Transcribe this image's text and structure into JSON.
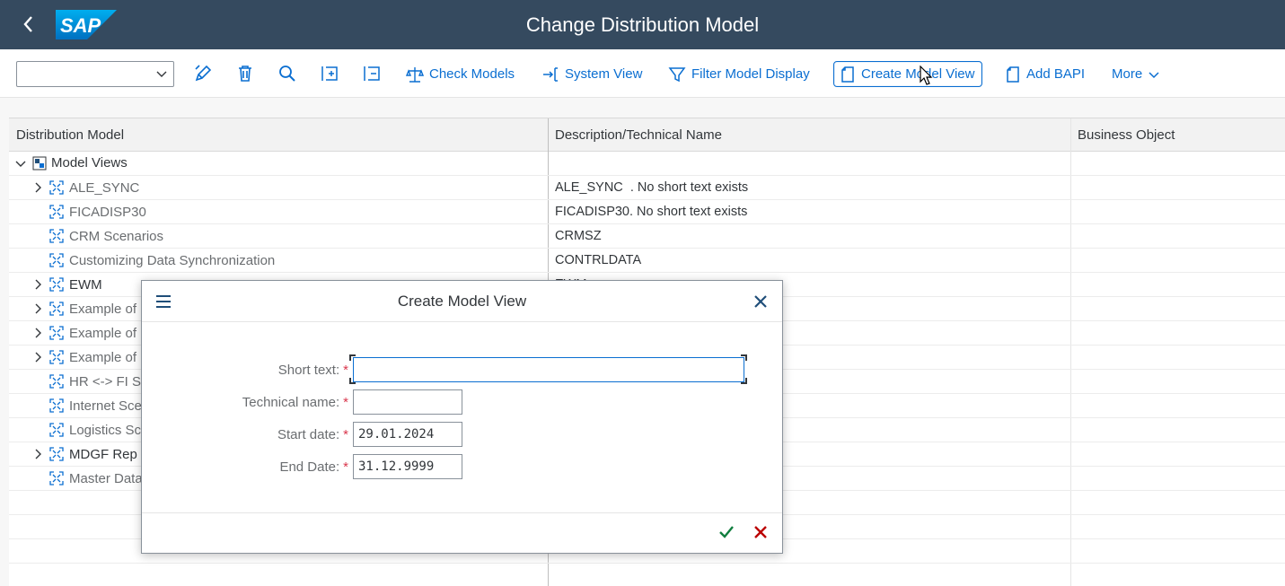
{
  "shell": {
    "back_icon": "back-arrow-icon",
    "logo_text": "SAP",
    "title": "Change Distribution Model"
  },
  "toolbar": {
    "dropdown_value": "",
    "icons": [
      "edit-icon",
      "delete-icon",
      "search-icon",
      "expand-all-icon",
      "collapse-all-icon"
    ],
    "buttons": [
      {
        "label": "Check Models",
        "icon": "scale-icon"
      },
      {
        "label": "System View",
        "icon": "system-view-icon"
      },
      {
        "label": "Filter Model Display",
        "icon": "filter-icon"
      },
      {
        "label": "Create Model View",
        "icon": "document-icon"
      },
      {
        "label": "Add BAPI",
        "icon": "document-icon"
      },
      {
        "label": "More",
        "icon": "chevron-down-icon"
      }
    ]
  },
  "table": {
    "columns": [
      "Distribution Model",
      "Description/Technical Name",
      "Business Object"
    ],
    "root": {
      "label": "Model Views",
      "expanded": true
    },
    "rows": [
      {
        "name": "ALE_SYNC",
        "desc": "ALE_SYNC  . No short text exists",
        "expandable": true,
        "bold": false
      },
      {
        "name": "FICADISP30",
        "desc": "FICADISP30. No short text exists",
        "expandable": false,
        "bold": false
      },
      {
        "name": "CRM Scenarios",
        "desc": "CRMSZ",
        "expandable": false,
        "bold": false
      },
      {
        "name": "Customizing Data Synchronization",
        "desc": "CONTRLDATA",
        "expandable": false,
        "bold": false
      },
      {
        "name": "EWM",
        "desc": "EWM",
        "expandable": true,
        "bold": true
      },
      {
        "name": "Example of",
        "desc": "",
        "expandable": true,
        "bold": false
      },
      {
        "name": "Example of",
        "desc": "",
        "expandable": true,
        "bold": false
      },
      {
        "name": "Example of",
        "desc": "",
        "expandable": true,
        "bold": false
      },
      {
        "name": "HR <-> FI S",
        "desc": "",
        "expandable": false,
        "bold": false
      },
      {
        "name": "Internet Sce",
        "desc": "",
        "expandable": false,
        "bold": false
      },
      {
        "name": "Logistics Sc",
        "desc": "",
        "expandable": false,
        "bold": false
      },
      {
        "name": "MDGF Rep",
        "desc": "",
        "expandable": true,
        "bold": true
      },
      {
        "name": "Master Data",
        "desc": "",
        "expandable": false,
        "bold": false
      }
    ]
  },
  "dialog": {
    "title": "Create Model View",
    "fields": [
      {
        "label": "Short text:",
        "value": "",
        "required": true
      },
      {
        "label": "Technical name:",
        "value": "",
        "required": true
      },
      {
        "label": "Start date:",
        "value": "29.01.2024",
        "required": true
      },
      {
        "label": "End Date:",
        "value": "31.12.9999",
        "required": true
      }
    ],
    "required_mark": "*",
    "ok_icon": "checkmark-icon",
    "cancel_icon": "cancel-icon"
  },
  "colors": {
    "shell_bg": "#354a5f",
    "accent": "#0a6ed1",
    "ok_green": "#107e3e",
    "cancel_red": "#bb0000",
    "required_red": "#d9364c"
  }
}
